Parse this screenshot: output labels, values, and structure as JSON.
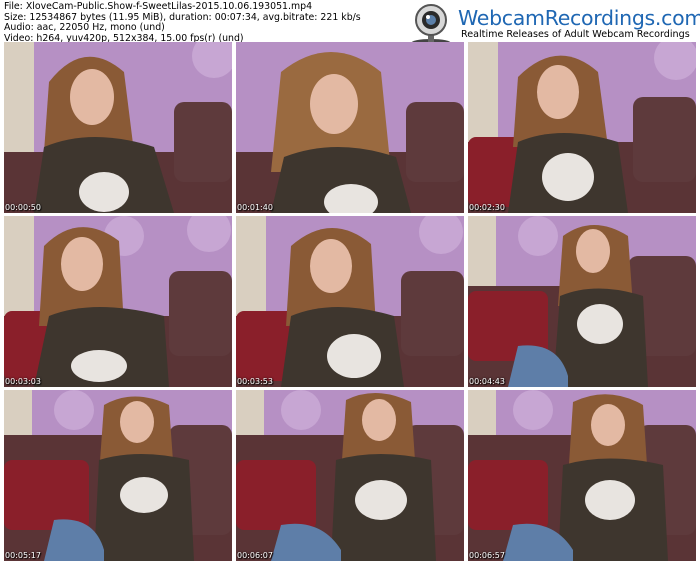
{
  "info": {
    "file": "File: XloveCam-Public.Show-f-SweetLilas-2015.10.06.193051.mp4",
    "size": "Size: 12534867 bytes (11.95 MiB), duration: 00:07:34, avg.bitrate: 221 kb/s",
    "audio": "Audio: aac, 22050 Hz, mono (und)",
    "video": "Video: h264, yuv420p, 512x384, 15.00 fps(r) (und)"
  },
  "logo": {
    "icon": "webcam-icon",
    "name": "WebcamRecordings.com",
    "tagline": "Realtime Releases of Adult Webcam Recordings"
  },
  "frames": [
    {
      "timestamp": "00:00:50"
    },
    {
      "timestamp": "00:01:40"
    },
    {
      "timestamp": "00:02:30"
    },
    {
      "timestamp": "00:03:03"
    },
    {
      "timestamp": "00:03:53"
    },
    {
      "timestamp": "00:04:43"
    },
    {
      "timestamp": "00:05:17"
    },
    {
      "timestamp": "00:06:07"
    },
    {
      "timestamp": "00:06:57"
    }
  ],
  "colors": {
    "brand_blue": "#1f67b3",
    "wall": "#b08fc0",
    "couch": "#5a3436",
    "sweater": "#3e362e",
    "hair": "#8a5a36"
  }
}
